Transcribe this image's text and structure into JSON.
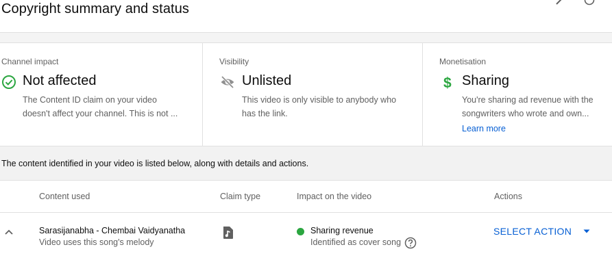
{
  "header": {
    "title": "Copyright summary and status"
  },
  "cards": {
    "channel": {
      "label": "Channel impact",
      "icon": "check-circle-icon",
      "status": "Not affected",
      "desc_line1": "The Content ID claim on your video",
      "desc_line2": "doesn't affect your channel. This is not ...",
      "color": "#2ba640"
    },
    "visibility": {
      "label": "Visibility",
      "icon": "eye-off-icon",
      "status": "Unlisted",
      "desc_line1": "This video is only visible to anybody who",
      "desc_line2": "has the link.",
      "color": "#909090"
    },
    "monetisation": {
      "label": "Monetisation",
      "icon": "dollar-icon",
      "status": "Sharing",
      "desc_line1": "You're sharing ad revenue with the",
      "desc_line2": "songwriters who wrote and own...",
      "link": "Learn more",
      "color": "#2ba640"
    }
  },
  "notice": {
    "text": "The content identified in your video is listed below, along with details and actions."
  },
  "table": {
    "headers": {
      "content": "Content used",
      "claim": "Claim type",
      "impact": "Impact on the video",
      "actions": "Actions"
    },
    "rows": [
      {
        "title": "Sarasijanabha - Chembai Vaidyanatha",
        "subtitle": "Video uses this song's melody",
        "claim_icon": "music-note-icon",
        "impact": "Sharing revenue",
        "impact_sub": "Identified as cover song",
        "impact_color": "#2ba640",
        "action": "SELECT ACTION"
      }
    ]
  },
  "colors": {
    "accent": "#065fd4",
    "success": "#2ba640",
    "muted": "#606060"
  }
}
